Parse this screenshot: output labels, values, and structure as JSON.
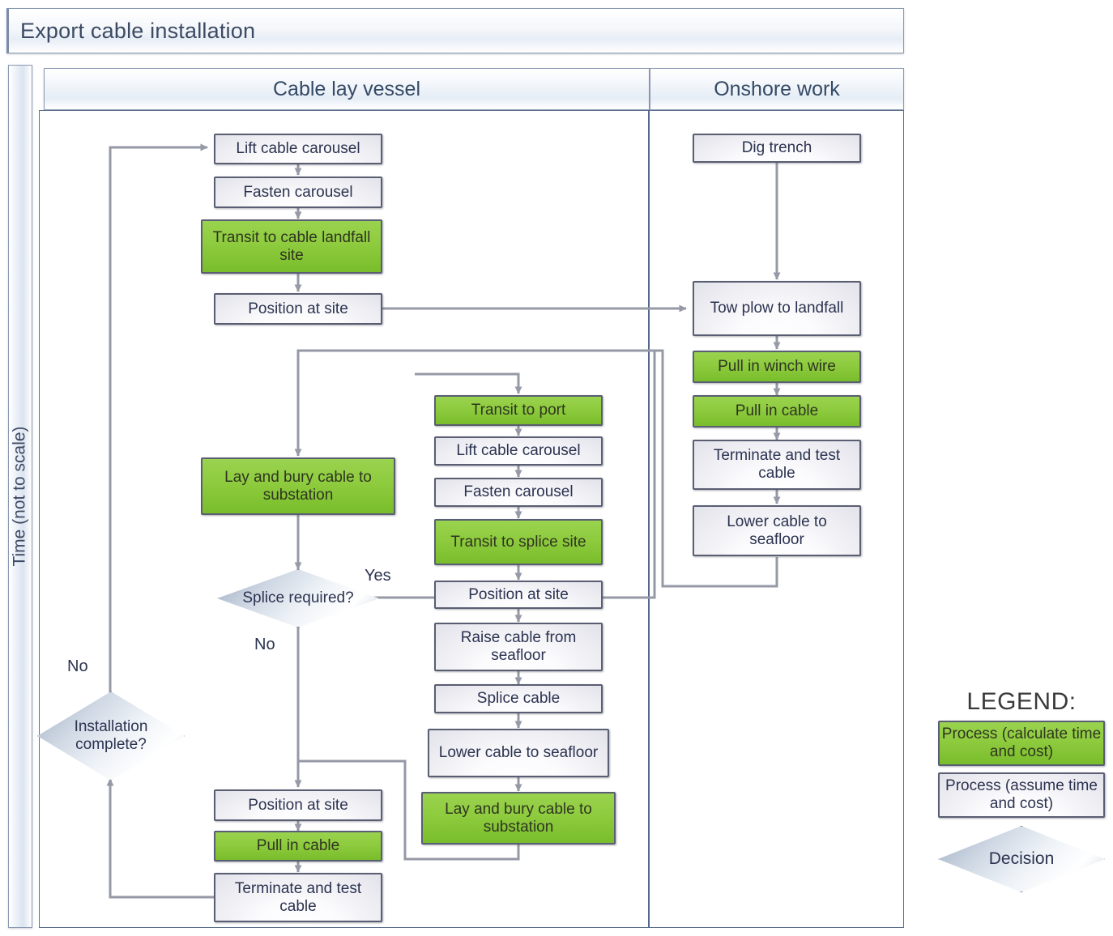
{
  "pool": {
    "title": "Export cable installation",
    "time_axis_label": "Time (not to scale)"
  },
  "lanes": [
    {
      "id": "cable-lay-vessel",
      "label": "Cable lay vessel"
    },
    {
      "id": "onshore-work",
      "label": "Onshore work"
    }
  ],
  "colors": {
    "process_calculate": "#8ecb3e",
    "process_assume": "#eef0f5",
    "decision": "#dde4ec",
    "node_border": "#595e72",
    "connector": "#8a8e9c",
    "text": "#2b3350"
  },
  "nodes": {
    "vessel_main": [
      {
        "id": "lift-cable-carousel-1",
        "label": "Lift cable carousel",
        "type": "process_assume"
      },
      {
        "id": "fasten-carousel-1",
        "label": "Fasten carousel",
        "type": "process_assume"
      },
      {
        "id": "transit-to-cable-landfall-site",
        "label": "Transit to cable landfall site",
        "type": "process_calculate"
      },
      {
        "id": "position-at-site-1",
        "label": "Position at site",
        "type": "process_assume"
      },
      {
        "id": "lay-and-bury-cable-to-substation-1",
        "label": "Lay and bury cable to substation",
        "type": "process_calculate"
      },
      {
        "id": "position-at-site-3",
        "label": "Position at site",
        "type": "process_assume"
      },
      {
        "id": "pull-in-cable-2",
        "label": "Pull in cable",
        "type": "process_calculate"
      },
      {
        "id": "terminate-and-test-cable-2",
        "label": "Terminate and test cable",
        "type": "process_assume"
      }
    ],
    "vessel_splice": [
      {
        "id": "transit-to-port",
        "label": "Transit to port",
        "type": "process_calculate"
      },
      {
        "id": "lift-cable-carousel-2",
        "label": "Lift cable carousel",
        "type": "process_assume"
      },
      {
        "id": "fasten-carousel-2",
        "label": "Fasten carousel",
        "type": "process_assume"
      },
      {
        "id": "transit-to-splice-site",
        "label": "Transit to splice site",
        "type": "process_calculate"
      },
      {
        "id": "position-at-site-2",
        "label": "Position at site",
        "type": "process_assume"
      },
      {
        "id": "raise-cable-from-seafloor",
        "label": "Raise cable from seafloor",
        "type": "process_assume"
      },
      {
        "id": "splice-cable",
        "label": "Splice cable",
        "type": "process_assume"
      },
      {
        "id": "lower-cable-to-seafloor-2",
        "label": "Lower cable to seafloor",
        "type": "process_assume"
      },
      {
        "id": "lay-and-bury-cable-to-substation-2",
        "label": "Lay and bury cable to substation",
        "type": "process_calculate"
      }
    ],
    "onshore": [
      {
        "id": "dig-trench",
        "label": "Dig trench",
        "type": "process_assume"
      },
      {
        "id": "tow-plow-to-landfall",
        "label": "Tow plow to landfall",
        "type": "process_assume"
      },
      {
        "id": "pull-in-winch-wire",
        "label": "Pull in winch wire",
        "type": "process_calculate"
      },
      {
        "id": "pull-in-cable-1",
        "label": "Pull in cable",
        "type": "process_calculate"
      },
      {
        "id": "terminate-and-test-cable-1",
        "label": "Terminate and test cable",
        "type": "process_assume"
      },
      {
        "id": "lower-cable-to-seafloor-1",
        "label": "Lower cable to seafloor",
        "type": "process_assume"
      }
    ]
  },
  "decisions": [
    {
      "id": "splice-required",
      "label": "Splice required?"
    },
    {
      "id": "installation-complete",
      "label": "Installation complete?"
    }
  ],
  "edge_labels": {
    "splice_yes": "Yes",
    "splice_no": "No",
    "installation_no": "No"
  },
  "legend": {
    "title": "LEGEND:",
    "items": [
      {
        "id": "legend-process-calculate",
        "label": "Process (calculate time and cost)",
        "type": "process_calculate"
      },
      {
        "id": "legend-process-assume",
        "label": "Process (assume time and cost)",
        "type": "process_assume"
      },
      {
        "id": "legend-decision",
        "label": "Decision",
        "type": "decision"
      }
    ]
  }
}
